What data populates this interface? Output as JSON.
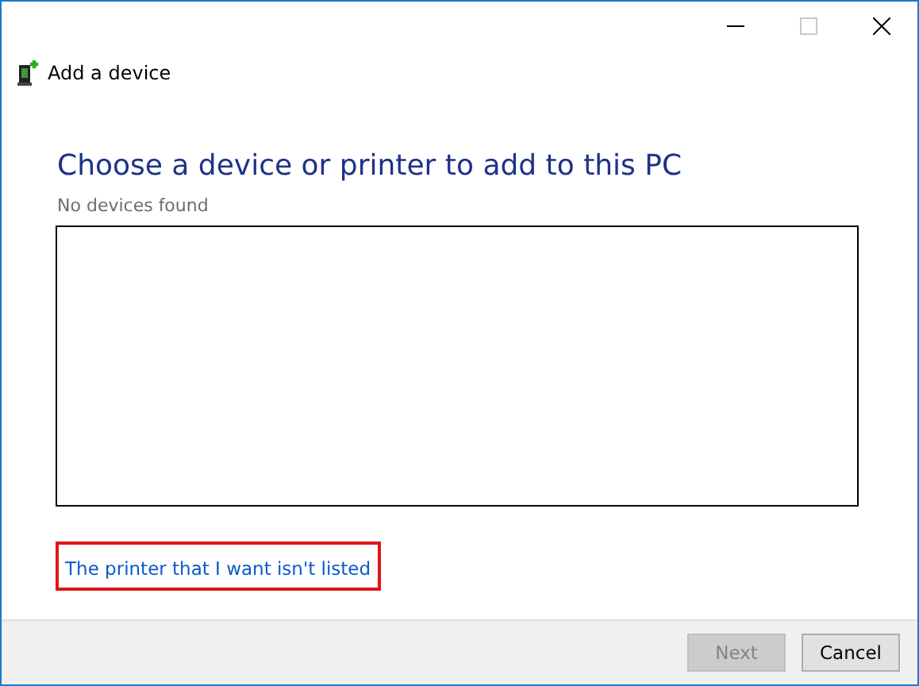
{
  "window": {
    "title": "Add a device",
    "maximize_disabled": true
  },
  "heading": "Choose a device or printer to add to this PC",
  "status": "No devices found",
  "link": {
    "text": "The printer that I want isn't listed",
    "highlighted": true
  },
  "buttons": [
    {
      "label": "Next",
      "disabled": true
    },
    {
      "label": "Cancel",
      "disabled": false
    }
  ]
}
